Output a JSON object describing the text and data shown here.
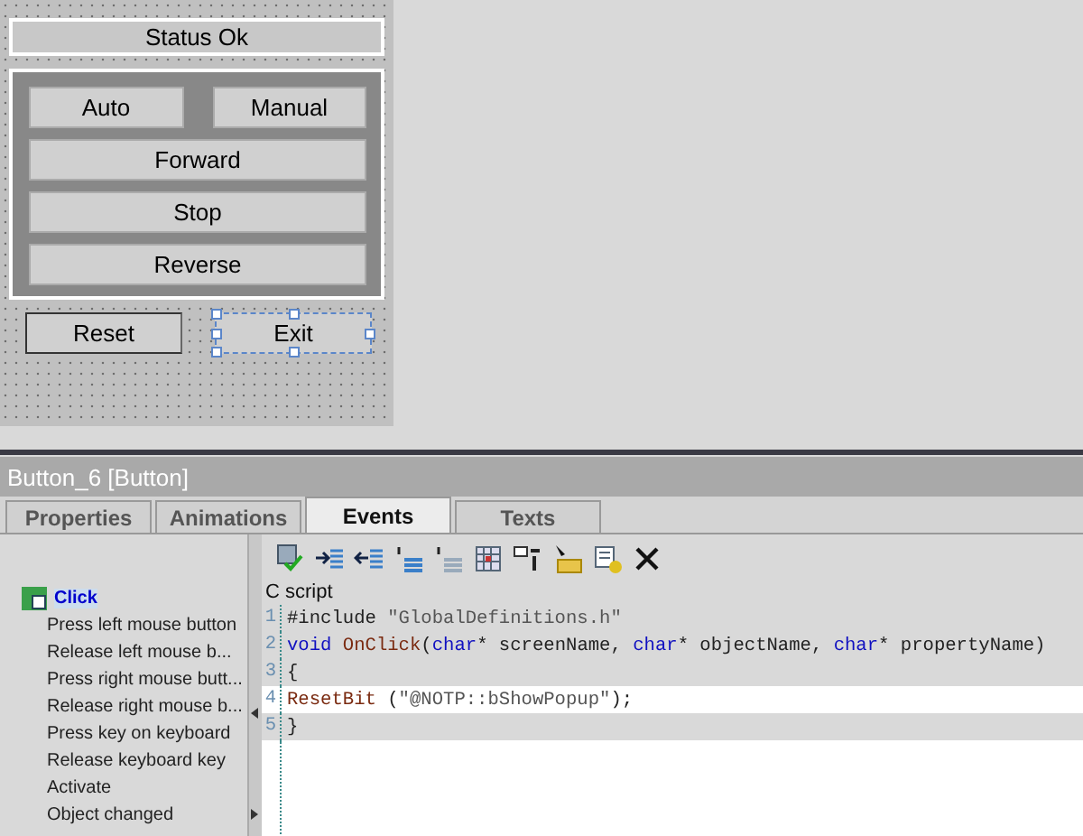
{
  "screen": {
    "status": "Status Ok",
    "panel_buttons": [
      {
        "label": "Auto",
        "wide": false
      },
      {
        "label": "Manual",
        "wide": false
      },
      {
        "label": "Forward",
        "wide": true
      },
      {
        "label": "Stop",
        "wide": true
      },
      {
        "label": "Reverse",
        "wide": true
      }
    ],
    "bottom_buttons": [
      {
        "label": "Reset",
        "selected": false
      },
      {
        "label": "Exit",
        "selected": true
      }
    ]
  },
  "inspector": {
    "title": "Button_6 [Button]",
    "tabs": [
      {
        "label": "Properties",
        "selected": false
      },
      {
        "label": "Animations",
        "selected": false
      },
      {
        "label": "Events",
        "selected": true
      },
      {
        "label": "Texts",
        "selected": false
      }
    ],
    "events": [
      {
        "label": "Click",
        "selected": true
      },
      {
        "label": "Press left mouse button",
        "selected": false
      },
      {
        "label": "Release left mouse b...",
        "selected": false
      },
      {
        "label": "Press right mouse butt...",
        "selected": false
      },
      {
        "label": "Release right mouse b...",
        "selected": false
      },
      {
        "label": "Press key on keyboard",
        "selected": false
      },
      {
        "label": "Release keyboard key",
        "selected": false
      },
      {
        "label": "Activate",
        "selected": false
      },
      {
        "label": "Object changed",
        "selected": false
      }
    ],
    "script_label": "C script",
    "code": [
      {
        "number": "1",
        "selected": false,
        "tokens": [
          {
            "kind": "text",
            "text": "#include "
          },
          {
            "kind": "string",
            "text": "\"GlobalDefinitions.h\""
          }
        ]
      },
      {
        "number": "2",
        "selected": false,
        "tokens": [
          {
            "kind": "keyword",
            "text": "void "
          },
          {
            "kind": "ident",
            "text": "OnClick"
          },
          {
            "kind": "text",
            "text": "("
          },
          {
            "kind": "keyword",
            "text": "char"
          },
          {
            "kind": "text",
            "text": "* screenName, "
          },
          {
            "kind": "keyword",
            "text": "char"
          },
          {
            "kind": "text",
            "text": "* objectName, "
          },
          {
            "kind": "keyword",
            "text": "char"
          },
          {
            "kind": "text",
            "text": "* propertyName)"
          }
        ]
      },
      {
        "number": "3",
        "selected": false,
        "tokens": [
          {
            "kind": "text",
            "text": "{"
          }
        ]
      },
      {
        "number": "4",
        "selected": true,
        "tokens": [
          {
            "kind": "ident",
            "text": "ResetBit"
          },
          {
            "kind": "text",
            "text": " ("
          },
          {
            "kind": "string",
            "text": "\"@NOTP::bShowPopup\""
          },
          {
            "kind": "text",
            "text": ");"
          }
        ]
      },
      {
        "number": "5",
        "selected": false,
        "tokens": [
          {
            "kind": "text",
            "text": "}"
          }
        ]
      }
    ]
  }
}
